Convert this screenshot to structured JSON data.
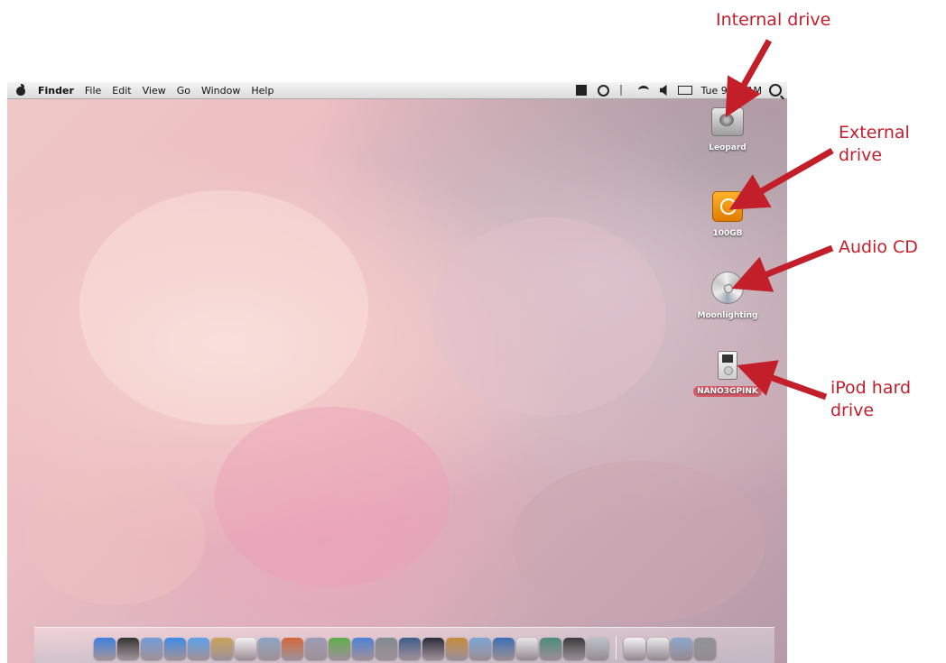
{
  "menubar": {
    "app_name": "Finder",
    "menus": [
      "File",
      "Edit",
      "View",
      "Go",
      "Window",
      "Help"
    ],
    "clock": "Tue 9:13 AM"
  },
  "desktop_icons": [
    {
      "label": "Leopard",
      "icon": "hard-drive-icon"
    },
    {
      "label": "100GB",
      "icon": "external-drive-icon"
    },
    {
      "label": "Moonlighting",
      "icon": "audio-cd-icon"
    },
    {
      "label": "NANO3GPINK",
      "icon": "ipod-icon",
      "selected": true
    }
  ],
  "callouts": {
    "internal": "Internal drive",
    "external_1": "External",
    "external_2": "drive",
    "audio": "Audio CD",
    "ipod_1": "iPod hard",
    "ipod_2": "drive"
  },
  "colors": {
    "callout": "#c21f2b",
    "selected_label": "#d85a6a"
  },
  "dock": {
    "apps": [
      {
        "name": "finder-icon",
        "color": "#3d7fe0"
      },
      {
        "name": "dashboard-icon",
        "color": "#333333"
      },
      {
        "name": "mail-icon",
        "color": "#6f9bd8"
      },
      {
        "name": "safari-icon",
        "color": "#3b8be6"
      },
      {
        "name": "ichat-icon",
        "color": "#5aa0e8"
      },
      {
        "name": "address-book-icon",
        "color": "#c9a25a"
      },
      {
        "name": "ical-icon",
        "color": "#f1f1f1"
      },
      {
        "name": "preview-icon",
        "color": "#8aa5c2"
      },
      {
        "name": "keynote-icon",
        "color": "#d2673c"
      },
      {
        "name": "pages-icon",
        "color": "#9b9bb5"
      },
      {
        "name": "numbers-icon",
        "color": "#5dae4a"
      },
      {
        "name": "itunes-icon",
        "color": "#4c82d6"
      },
      {
        "name": "iphoto-icon",
        "color": "#7f8a8f"
      },
      {
        "name": "imovie-icon",
        "color": "#3c5b8c"
      },
      {
        "name": "idvd-icon",
        "color": "#2b2b3a"
      },
      {
        "name": "garageband-icon",
        "color": "#c78b3c"
      },
      {
        "name": "iweb-icon",
        "color": "#7da4d4"
      },
      {
        "name": "spaces-icon",
        "color": "#3a6fb5"
      },
      {
        "name": "textedit-icon",
        "color": "#e6e6e6"
      },
      {
        "name": "time-machine-icon",
        "color": "#4c8c7a"
      },
      {
        "name": "photo-booth-icon",
        "color": "#3a3a3a"
      },
      {
        "name": "image-capture-icon",
        "color": "#b9c2c9"
      }
    ],
    "stacks": [
      {
        "name": "documents-stack-icon",
        "color": "#f3f3f3"
      },
      {
        "name": "downloads-stack-icon",
        "color": "#e8e8e8"
      },
      {
        "name": "mail-stack-icon",
        "color": "#8aa6cc"
      },
      {
        "name": "trash-icon",
        "color": "#8e9499"
      }
    ]
  }
}
